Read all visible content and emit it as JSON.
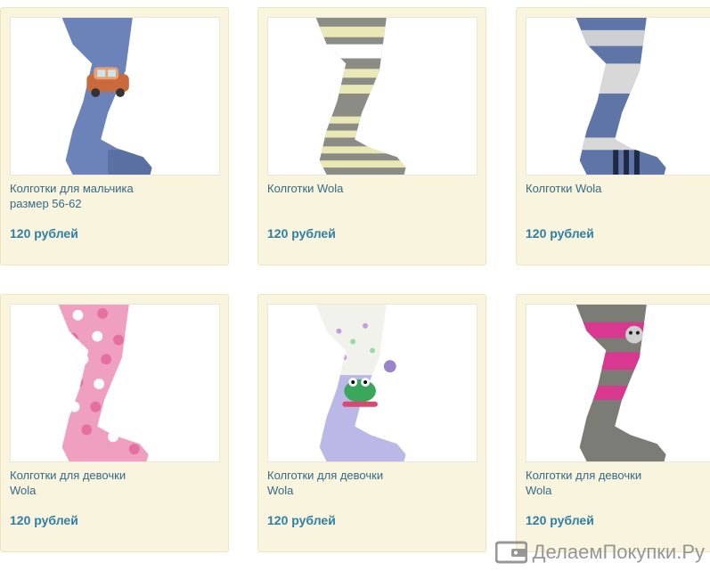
{
  "products": [
    {
      "name": "Колготки для мальчика\nразмер 56-62",
      "price": "120 рублей",
      "image_icon": "tights-blue-car-icon"
    },
    {
      "name": "Колготки Wola",
      "price": "120 рублей",
      "image_icon": "tights-grey-yellow-stripes-icon"
    },
    {
      "name": "Колготки Wola",
      "price": "120 рублей",
      "image_icon": "tights-blue-grey-stripes-icon"
    },
    {
      "name": "Колготки для девочки\nWola",
      "price": "120 рублей",
      "image_icon": "tights-pink-dots-icon"
    },
    {
      "name": "Колготки для девочки\nWola",
      "price": "120 рублей",
      "image_icon": "tights-lilac-frog-icon"
    },
    {
      "name": "Колготки для девочки\nWola",
      "price": "120 рублей",
      "image_icon": "tights-grey-pink-stripes-icon"
    }
  ],
  "watermark": {
    "text": "ДелаемПокупки.Ру",
    "icon": "wallet-logo-icon"
  },
  "colors": {
    "card_bg": "#f8f4dd",
    "name": "#356a86",
    "price": "#2f7fa5"
  }
}
